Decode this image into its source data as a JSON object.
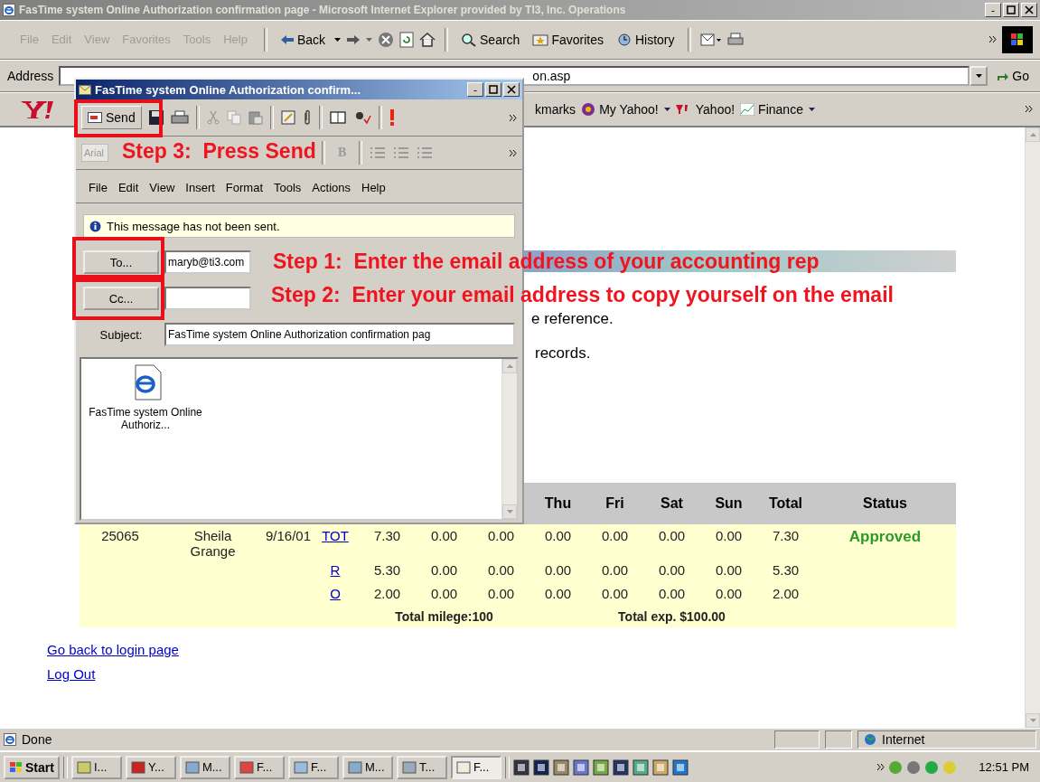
{
  "window": {
    "title": "FasTime system Online Authorization confirmation page - Microsoft Internet Explorer provided by TI3, Inc. Operations"
  },
  "menu": [
    {
      "label": "File",
      "disabled": true
    },
    {
      "label": "Edit",
      "disabled": true
    },
    {
      "label": "View",
      "disabled": true
    },
    {
      "label": "Favorites",
      "disabled": true
    },
    {
      "label": "Tools",
      "disabled": true
    },
    {
      "label": "Help",
      "disabled": true
    }
  ],
  "toolbar": [
    {
      "kind": "back",
      "label": "Back"
    },
    {
      "kind": "search",
      "label": "Search"
    },
    {
      "kind": "favorites",
      "label": "Favorites"
    },
    {
      "kind": "history",
      "label": "History"
    }
  ],
  "address": {
    "label": "Address",
    "value": "on.asp",
    "go": "Go"
  },
  "links": [
    {
      "label": "kmarks"
    },
    {
      "label": "My Yahoo!"
    },
    {
      "label": "Yahoo!"
    },
    {
      "label": "Finance"
    }
  ],
  "page": {
    "texts": [
      "e reference.",
      "records."
    ],
    "table": {
      "columns": [
        "Thu",
        "Fri",
        "Sat",
        "Sun",
        "Total",
        "Status"
      ],
      "rows": [
        {
          "id": "25065",
          "name": "Sheila Grange",
          "date": "9/16/01",
          "code": "TOT",
          "hours": [
            "7.30",
            "0.00",
            "0.00",
            "0.00",
            "0.00",
            "0.00",
            "0.00",
            "7.30"
          ],
          "status": "Approved"
        },
        {
          "code": "R",
          "hours": [
            "5.30",
            "0.00",
            "0.00",
            "0.00",
            "0.00",
            "0.00",
            "0.00",
            "5.30"
          ]
        },
        {
          "code": "O",
          "hours": [
            "2.00",
            "0.00",
            "0.00",
            "0.00",
            "0.00",
            "0.00",
            "0.00",
            "2.00"
          ]
        }
      ],
      "mileage": "Total milege:100",
      "expense": "Total exp. $100.00"
    },
    "links": [
      "Go back to login page",
      "Log Out"
    ]
  },
  "status_bar": {
    "text": "Done",
    "zone": "Internet"
  },
  "taskbar": {
    "start": "Start",
    "items": [
      {
        "label": "I...",
        "selected": false
      },
      {
        "label": "Y...",
        "selected": false
      },
      {
        "label": "M...",
        "selected": false
      },
      {
        "label": "F...",
        "selected": false
      },
      {
        "label": "F...",
        "selected": false
      },
      {
        "label": "M...",
        "selected": false
      },
      {
        "label": "T...",
        "selected": false
      },
      {
        "label": "F...",
        "selected": true
      }
    ],
    "time": "12:51 PM"
  },
  "mail": {
    "title": "FasTime system Online Authorization confirm...",
    "send": "Send",
    "font": "Arial",
    "bold": "B",
    "menu": [
      "File",
      "Edit",
      "View",
      "Insert",
      "Format",
      "Tools",
      "Actions",
      "Help"
    ],
    "info": "This message has not been sent.",
    "to": {
      "button": "To...",
      "value": "maryb@ti3.com"
    },
    "cc": {
      "button": "Cc..."
    },
    "subject": {
      "label": "Subject:",
      "value": "FasTime system Online Authorization confirmation pag"
    },
    "attachment": "FasTime system Online Authoriz..."
  },
  "annotations": [
    "Step 3:  Press Send",
    "Step 1:  Enter the email address of your accounting rep",
    "Step 2:  Enter your email address to copy yourself on the email"
  ]
}
